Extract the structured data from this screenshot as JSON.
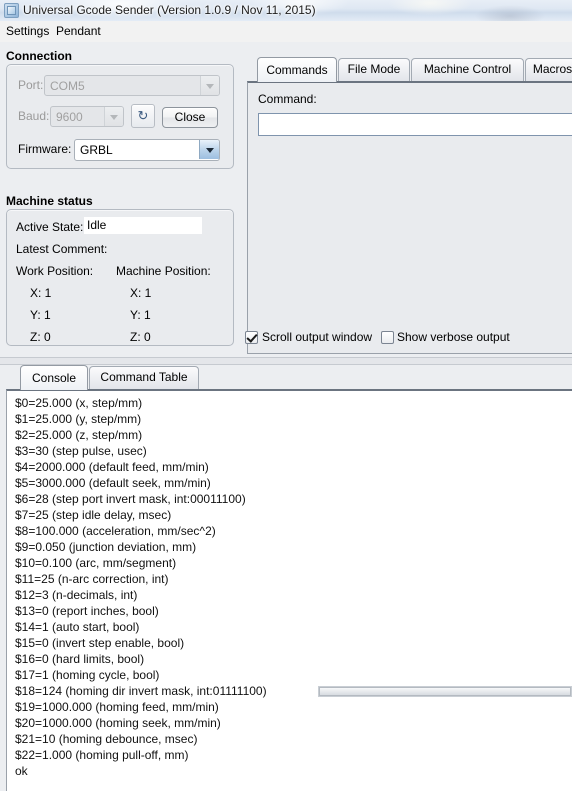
{
  "window": {
    "title": "Universal Gcode Sender (Version 1.0.9 / Nov 11, 2015)",
    "icon": "app-icon"
  },
  "menubar": {
    "items": [
      {
        "label": "Settings"
      },
      {
        "label": "Pendant"
      }
    ]
  },
  "connection": {
    "title": "Connection",
    "port": {
      "label": "Port:",
      "value": "COM5",
      "enabled": false
    },
    "baud": {
      "label": "Baud:",
      "value": "9600",
      "enabled": false
    },
    "refresh_icon": "refresh-icon",
    "refresh_glyph": "↻",
    "close_button": "Close",
    "firmware": {
      "label": "Firmware:",
      "value": "GRBL",
      "enabled": true
    }
  },
  "machine_status": {
    "title": "Machine status",
    "active_state_label": "Active State:",
    "active_state_value": "Idle",
    "latest_comment_label": "Latest Comment:",
    "latest_comment_value": "",
    "work_position_label": "Work Position:",
    "machine_position_label": "Machine Position:",
    "work_position": {
      "x": "X:  1",
      "y": "Y:  1",
      "z": "Z:  0"
    },
    "machine_position": {
      "x": "X:  1",
      "y": "Y:  1",
      "z": "Z:  0"
    }
  },
  "right_panel": {
    "tabs": [
      {
        "label": "Commands",
        "selected": true
      },
      {
        "label": "File Mode",
        "selected": false
      },
      {
        "label": "Machine Control",
        "selected": false
      },
      {
        "label": "Macros",
        "selected": false
      }
    ],
    "command_label": "Command:",
    "command_value": "",
    "command_placeholder": ""
  },
  "options": {
    "scroll_output_window": {
      "label": "Scroll output window",
      "checked": true
    },
    "show_verbose_output": {
      "label": "Show verbose output",
      "checked": false
    }
  },
  "console": {
    "tabs": [
      {
        "label": "Console",
        "selected": true
      },
      {
        "label": "Command Table",
        "selected": false
      }
    ],
    "lines": [
      "$0=25.000 (x, step/mm)",
      "$1=25.000 (y, step/mm)",
      "$2=25.000 (z, step/mm)",
      "$3=30 (step pulse, usec)",
      "$4=2000.000 (default feed, mm/min)",
      "$5=3000.000 (default seek, mm/min)",
      "$6=28 (step port invert mask, int:00011100)",
      "$7=25 (step idle delay, msec)",
      "$8=100.000 (acceleration, mm/sec^2)",
      "$9=0.050 (junction deviation, mm)",
      "$10=0.100 (arc, mm/segment)",
      "$11=25 (n-arc correction, int)",
      "$12=3 (n-decimals, int)",
      "$13=0 (report inches, bool)",
      "$14=1 (auto start, bool)",
      "$15=0 (invert step enable, bool)",
      "$16=0 (hard limits, bool)",
      "$17=1 (homing cycle, bool)",
      "$18=124 (homing dir invert mask, int:01111100)",
      "$19=1000.000 (homing feed, mm/min)",
      "$20=1000.000 (homing seek, mm/min)",
      "$21=10 (homing debounce, msec)",
      "$22=1.000 (homing pull-off, mm)",
      "ok"
    ]
  },
  "colors": {
    "panel_bg": "#e9ebee",
    "app_bg": "#eceef1",
    "titlebar": "#dfe8f3",
    "border": "#b4bac2",
    "accent_blue": "#9dbfe0",
    "text": "#000000",
    "disabled_text": "#9a9a9a"
  }
}
